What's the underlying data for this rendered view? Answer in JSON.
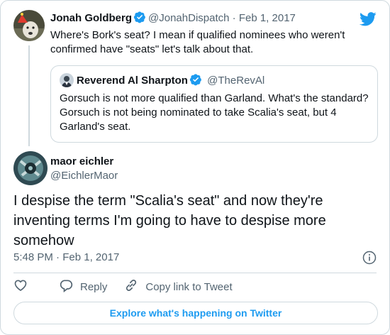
{
  "colors": {
    "accent": "#1d9bf0",
    "text": "#0f1419",
    "secondary": "#536471",
    "border": "#cfd9de"
  },
  "parent_tweet": {
    "name": "Jonah Goldberg",
    "handle": "@JonahDispatch",
    "separator": "·",
    "date": "Feb 1, 2017",
    "text": "Where's Bork's seat? I mean if qualified nominees who weren't confirmed have \"seats\" let's talk about that.",
    "verified_icon": "verified-badge-icon"
  },
  "quote_tweet": {
    "name": "Reverend Al Sharpton",
    "handle": "@TheRevAl",
    "text": "Gorsuch is not more qualified than Garland. What's the standard? Gorsuch is not being nominated to take Scalia's seat, but 4 Garland's seat.",
    "verified_icon": "verified-badge-icon"
  },
  "main_tweet": {
    "name": "maor eichler",
    "handle": "@EichlerMaor",
    "text": "I despise the term \"Scalia's seat\" and now they're inventing terms I'm going to have to despise more somehow",
    "time": "5:48 PM",
    "separator": "·",
    "date": "Feb 1, 2017"
  },
  "actions": {
    "like_icon": "heart-icon",
    "reply_label": "Reply",
    "copy_link_label": "Copy link to Tweet"
  },
  "explore_label": "Explore what's happening on Twitter"
}
